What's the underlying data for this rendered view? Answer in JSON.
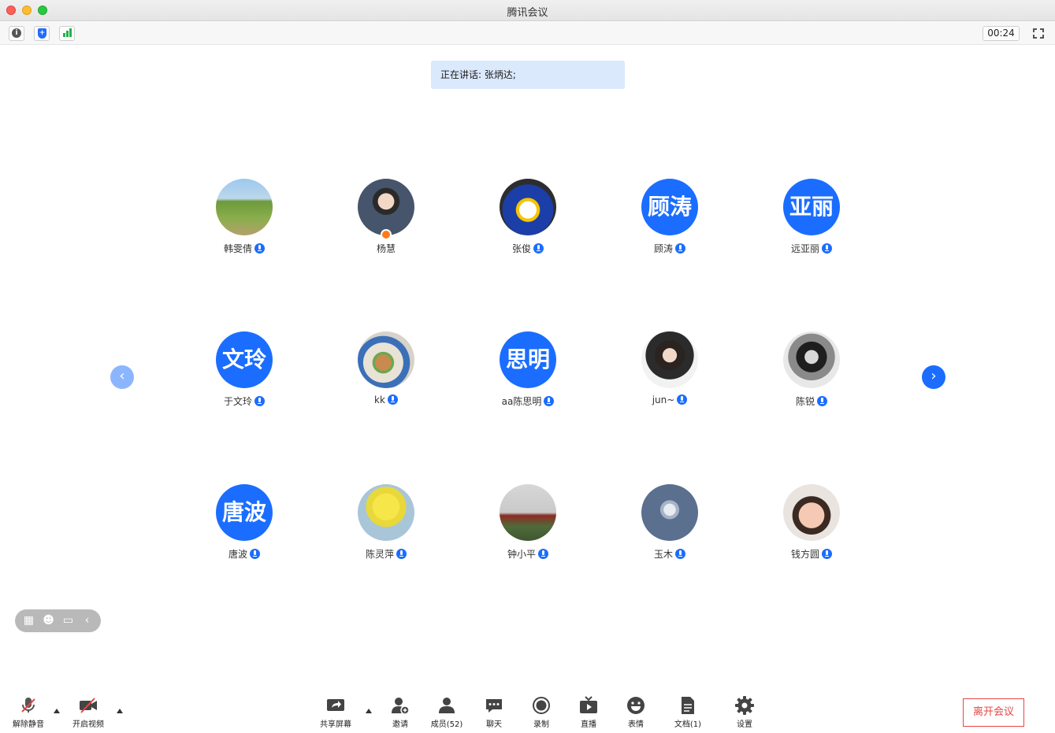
{
  "window": {
    "title": "腾讯会议"
  },
  "infobar": {
    "timer": "00:24"
  },
  "speaking": {
    "text": "正在讲话: 张炳达;"
  },
  "participants": [
    {
      "name": "韩雯倩",
      "avatar_type": "photo",
      "muted": false
    },
    {
      "name": "杨慧",
      "avatar_type": "photo",
      "host": true
    },
    {
      "name": "张俊",
      "avatar_type": "photo"
    },
    {
      "name": "顾涛",
      "avatar_type": "text",
      "avatar_text": "顾涛"
    },
    {
      "name": "远亚丽",
      "avatar_type": "text",
      "avatar_text": "亚丽"
    },
    {
      "name": "于文玲",
      "avatar_type": "text",
      "avatar_text": "文玲"
    },
    {
      "name": "kk",
      "avatar_type": "photo"
    },
    {
      "name": "aa陈思明",
      "avatar_type": "text",
      "avatar_text": "思明"
    },
    {
      "name": "jun~",
      "avatar_type": "photo"
    },
    {
      "name": "陈锐",
      "avatar_type": "photo"
    },
    {
      "name": "唐波",
      "avatar_type": "text",
      "avatar_text": "唐波"
    },
    {
      "name": "陈灵萍",
      "avatar_type": "photo"
    },
    {
      "name": "钟小平",
      "avatar_type": "photo"
    },
    {
      "name": "玉木",
      "avatar_type": "photo"
    },
    {
      "name": "钱方圆",
      "avatar_type": "photo"
    }
  ],
  "toolbar": {
    "unmute": "解除静音",
    "start_video": "开启视频",
    "share_screen": "共享屏幕",
    "invite": "邀请",
    "members": "成员(52)",
    "chat": "聊天",
    "record": "录制",
    "live": "直播",
    "emoji": "表情",
    "docs": "文档(1)",
    "settings": "设置",
    "leave": "离开会议"
  },
  "colors": {
    "accent": "#1a6dff",
    "leave": "#e64545",
    "speaking_bg": "#dbe9fd"
  }
}
